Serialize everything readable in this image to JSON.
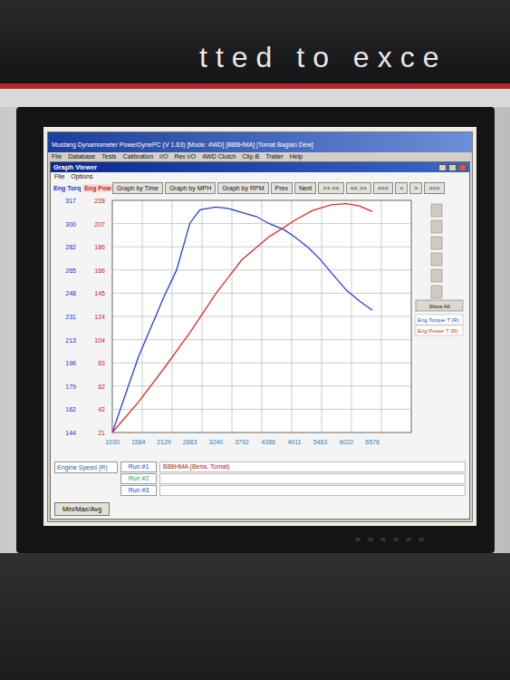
{
  "banner": {
    "text": "tted to exce"
  },
  "app": {
    "title": "Mustang Dynamometer PowerDynePC (V 1.63) [Mode: 4WD] [B88HMA] [Tomat Bagian Dew]",
    "menu": [
      "File",
      "Database",
      "Tests",
      "Calibration",
      "I/O",
      "Rev I/O",
      "4WD Clutch",
      "Clip B",
      "Trailer",
      "Help"
    ]
  },
  "viewer": {
    "title": "Graph Viewer",
    "menu": [
      "File",
      "Options"
    ]
  },
  "toolbar": [
    {
      "label": "Graph by Time",
      "selected": false
    },
    {
      "label": "Graph by MPH",
      "selected": false
    },
    {
      "label": "Graph by RPM",
      "selected": false
    },
    {
      "label": "Prev",
      "selected": false
    },
    {
      "label": "Next",
      "selected": false
    },
    {
      "label": ">> <<",
      "selected": false
    },
    {
      "label": "<< >>",
      "selected": false
    },
    {
      "label": "<<<",
      "selected": false
    },
    {
      "label": "<",
      "selected": false
    },
    {
      "label": ">",
      "selected": false
    },
    {
      "label": ">>>",
      "selected": false
    }
  ],
  "chart": {
    "torque": {
      "label": "Eng Torq",
      "ticks": [
        "317",
        "300",
        "282",
        "265",
        "248",
        "231",
        "213",
        "196",
        "179",
        "162",
        "144"
      ]
    },
    "power": {
      "label": "Eng Pow",
      "ticks": [
        "228",
        "207",
        "186",
        "166",
        "145",
        "124",
        "104",
        "83",
        "62",
        "42",
        "21"
      ]
    },
    "rpm": {
      "label": "Engine Speed (R)",
      "ticks": [
        "1030",
        "1584",
        "2129",
        "2683",
        "3240",
        "3792",
        "4356",
        "4911",
        "5463",
        "6022",
        "6576"
      ]
    },
    "show_all": "Show All",
    "series": [
      {
        "name": "Eng Torque T (R)",
        "axis": "torque",
        "color": "#2a3fd6",
        "rpm": [
          1030,
          1584,
          2129,
          2400,
          2683,
          2900,
          3240,
          3500,
          3792,
          4100,
          4356,
          4700,
          4911,
          5200,
          5463,
          5700,
          6022,
          6300,
          6576
        ],
        "values": [
          144,
          200,
          245,
          265,
          300,
          310,
          312,
          311,
          308,
          305,
          300,
          295,
          290,
          282,
          273,
          263,
          250,
          242,
          235
        ]
      },
      {
        "name": "Eng Power T (R)",
        "axis": "power",
        "color": "#e02828",
        "rpm": [
          1030,
          1584,
          2129,
          2683,
          3240,
          3792,
          4356,
          4911,
          5300,
          5700,
          6022,
          6300,
          6576
        ],
        "values": [
          21,
          48,
          78,
          110,
          145,
          175,
          195,
          210,
          219,
          224,
          225,
          223,
          218
        ]
      }
    ]
  },
  "runs": [
    {
      "label": "Run #1",
      "name": "B88HMA (Bena, Tomat)",
      "color": "#1f3fd0"
    },
    {
      "label": "Run #2",
      "name": "",
      "color": "#1a9a3a"
    },
    {
      "label": "Run #3",
      "name": "",
      "color": "#1f3fd0"
    }
  ],
  "min_max_button": "Min/Max/Avg"
}
